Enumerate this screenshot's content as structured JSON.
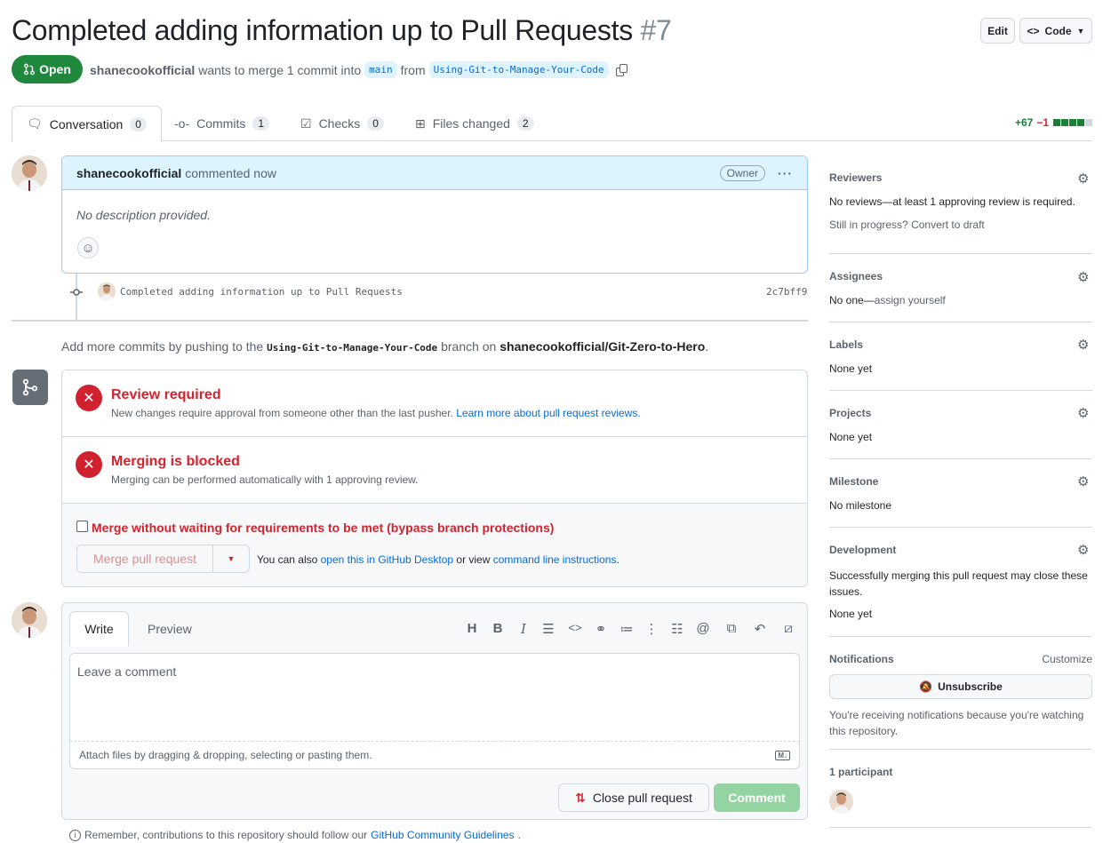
{
  "header": {
    "title": "Completed adding information up to Pull Requests",
    "number": "#7",
    "edit_label": "Edit",
    "code_label": "Code",
    "state_label": "Open",
    "author": "shanecookofficial",
    "merge_text": "wants to merge 1 commit into",
    "base_branch": "main",
    "from_text": "from",
    "head_branch": "Using-Git-to-Manage-Your-Code"
  },
  "tabs": [
    {
      "label": "Conversation",
      "count": "0"
    },
    {
      "label": "Commits",
      "count": "1"
    },
    {
      "label": "Checks",
      "count": "0"
    },
    {
      "label": "Files changed",
      "count": "2"
    }
  ],
  "diffstat": {
    "additions": "+67",
    "deletions": "−1"
  },
  "comment": {
    "author": "shanecookofficial",
    "time": "commented now",
    "badge": "Owner",
    "body": "No description provided."
  },
  "commit": {
    "message": "Completed adding information up to Pull Requests",
    "sha": "2c7bff9"
  },
  "push_hint": {
    "prefix": "Add more commits by pushing to the",
    "branch": "Using-Git-to-Manage-Your-Code",
    "middle": "branch on",
    "repo": "shanecookofficial/Git-Zero-to-Hero",
    "suffix": "."
  },
  "merge": {
    "review_title": "Review required",
    "review_desc": "New changes require approval from someone other than the last pusher.",
    "review_link": "Learn more about pull request reviews.",
    "blocked_title": "Merging is blocked",
    "blocked_desc": "Merging can be performed automatically with 1 approving review.",
    "bypass_label": "Merge without waiting for requirements to be met (bypass branch protections)",
    "merge_button": "Merge pull request",
    "also_text": "You can also",
    "desktop_link": "open this in GitHub Desktop",
    "or_text": "or view",
    "cli_link": "command line instructions",
    "period": "."
  },
  "editor": {
    "write_tab": "Write",
    "preview_tab": "Preview",
    "placeholder": "Leave a comment",
    "attach_text": "Attach files by dragging & dropping, selecting or pasting them.",
    "close_button": "Close pull request",
    "comment_button": "Comment",
    "remember_text": "Remember, contributions to this repository should follow our",
    "guidelines_link": "GitHub Community Guidelines",
    "remember_suffix": "."
  },
  "sidebar": {
    "reviewers": {
      "title": "Reviewers",
      "value": "No reviews—at least 1 approving review is required.",
      "progress_prefix": "Still in progress?",
      "draft_link": "Convert to draft"
    },
    "assignees": {
      "title": "Assignees",
      "value": "No one—",
      "assign_link": "assign yourself"
    },
    "labels": {
      "title": "Labels",
      "value": "None yet"
    },
    "projects": {
      "title": "Projects",
      "value": "None yet"
    },
    "milestone": {
      "title": "Milestone",
      "value": "No milestone"
    },
    "development": {
      "title": "Development",
      "desc": "Successfully merging this pull request may close these issues.",
      "value": "None yet"
    },
    "notifications": {
      "title": "Notifications",
      "customize": "Customize",
      "button": "Unsubscribe",
      "desc": "You're receiving notifications because you're watching this repository."
    },
    "participants": {
      "title": "1 participant"
    }
  },
  "colors": {
    "open_green": "#1f883d",
    "danger_red": "#cf222e",
    "link_blue": "#0969da",
    "comment_green": "#94d3a2"
  }
}
